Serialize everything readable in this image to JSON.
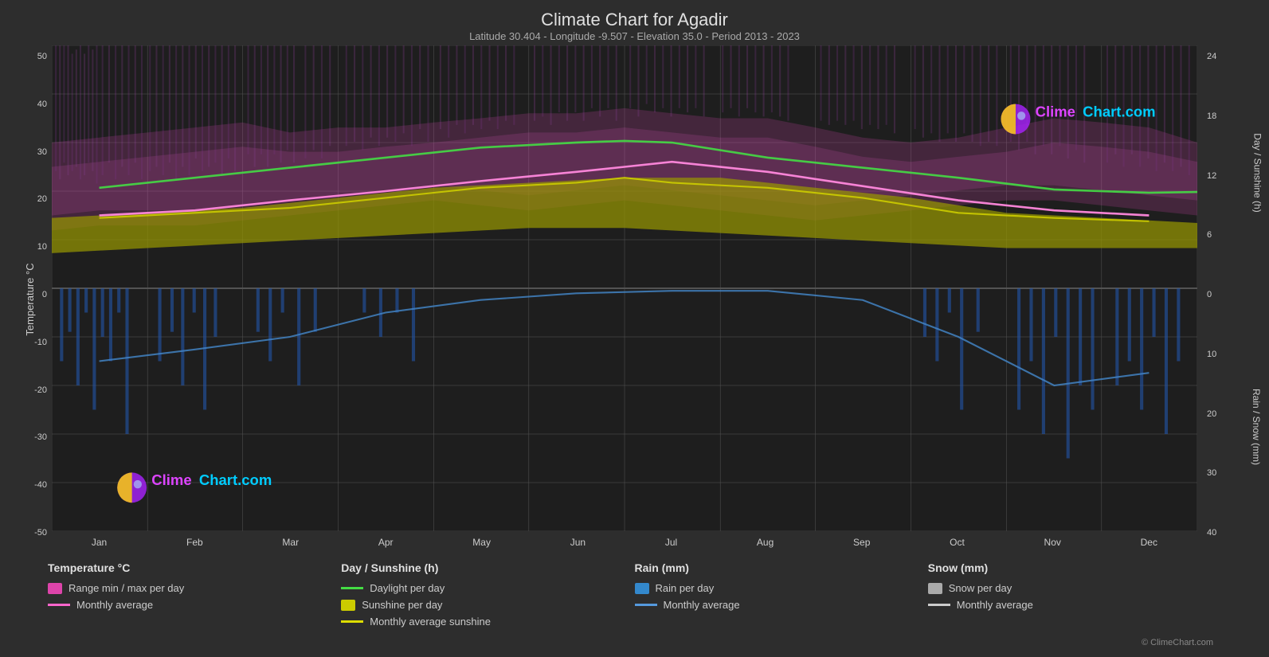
{
  "title": "Climate Chart for Agadir",
  "subtitle": "Latitude 30.404 - Longitude -9.507 - Elevation 35.0 - Period 2013 - 2023",
  "brand": {
    "name": "ClimeChart.com",
    "clime": "Clime",
    "chart_com": "Chart.com"
  },
  "copyright": "© ClimeChart.com",
  "x_axis": {
    "labels": [
      "Jan",
      "Feb",
      "Mar",
      "Apr",
      "May",
      "Jun",
      "Jul",
      "Aug",
      "Sep",
      "Oct",
      "Nov",
      "Dec"
    ]
  },
  "y_axis_left": {
    "label": "Temperature °C",
    "ticks": [
      "50",
      "40",
      "30",
      "20",
      "10",
      "0",
      "-10",
      "-20",
      "-30",
      "-40",
      "-50"
    ]
  },
  "y_axis_right_top": {
    "label": "Day / Sunshine (h)",
    "ticks": [
      "24",
      "18",
      "12",
      "6",
      "0"
    ]
  },
  "y_axis_right_bottom": {
    "label": "Rain / Snow (mm)",
    "ticks": [
      "0",
      "10",
      "20",
      "30",
      "40"
    ]
  },
  "legend": {
    "temperature": {
      "title": "Temperature °C",
      "items": [
        {
          "type": "swatch",
          "color": "#dd44aa",
          "label": "Range min / max per day"
        },
        {
          "type": "line",
          "color": "#ff66cc",
          "label": "Monthly average"
        }
      ]
    },
    "sunshine": {
      "title": "Day / Sunshine (h)",
      "items": [
        {
          "type": "line",
          "color": "#44dd44",
          "label": "Daylight per day"
        },
        {
          "type": "swatch",
          "color": "#cccc00",
          "label": "Sunshine per day"
        },
        {
          "type": "line",
          "color": "#dddd00",
          "label": "Monthly average sunshine"
        }
      ]
    },
    "rain": {
      "title": "Rain (mm)",
      "items": [
        {
          "type": "swatch",
          "color": "#3388cc",
          "label": "Rain per day"
        },
        {
          "type": "line",
          "color": "#5599dd",
          "label": "Monthly average"
        }
      ]
    },
    "snow": {
      "title": "Snow (mm)",
      "items": [
        {
          "type": "swatch",
          "color": "#aaaaaa",
          "label": "Snow per day"
        },
        {
          "type": "line",
          "color": "#cccccc",
          "label": "Monthly average"
        }
      ]
    }
  }
}
